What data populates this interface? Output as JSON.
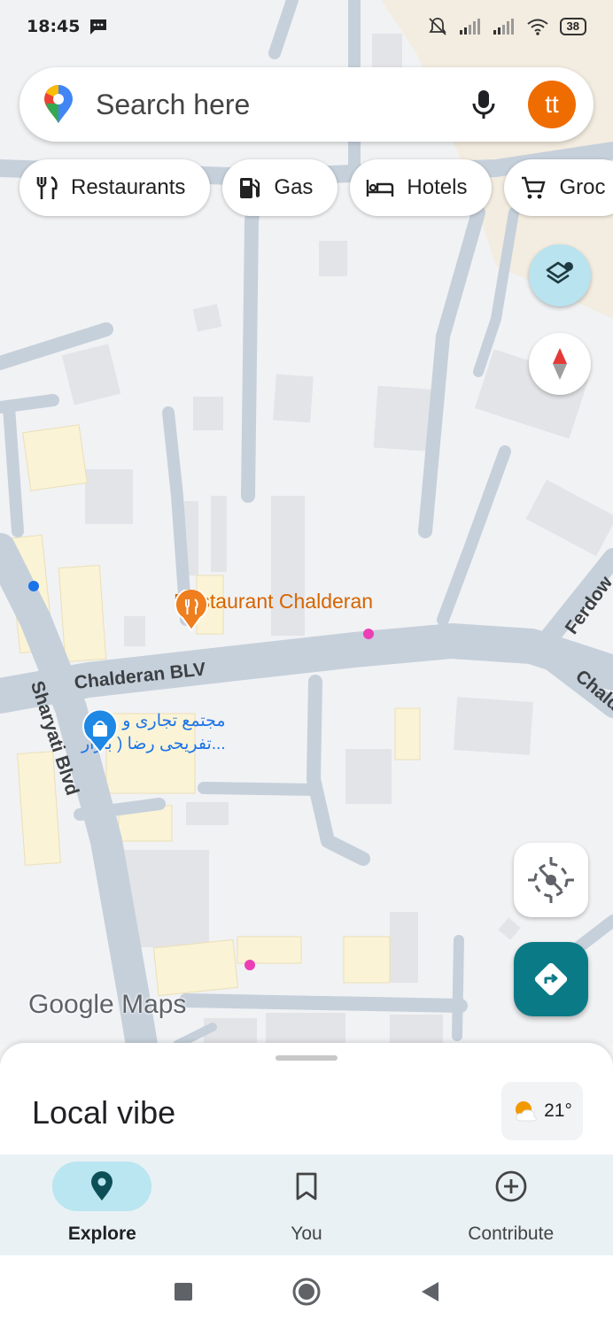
{
  "status_bar": {
    "time": "18:45",
    "battery": "38",
    "icons": [
      "message-icon",
      "mute-icon",
      "signal-icon",
      "signal-icon",
      "wifi-icon",
      "battery-icon"
    ]
  },
  "search": {
    "placeholder": "Search here",
    "avatar_initials": "tt",
    "colors": {
      "avatar": "#ef6c00"
    }
  },
  "chips": [
    {
      "label": "Restaurants",
      "icon": "fork-knife-icon"
    },
    {
      "label": "Gas",
      "icon": "gas-pump-icon"
    },
    {
      "label": "Hotels",
      "icon": "bed-icon"
    },
    {
      "label": "Groc",
      "icon": "cart-icon"
    }
  ],
  "map": {
    "streets": {
      "chalderan_blv": "Chalderan BLV",
      "sharyati_blvd": "Sharyati Blvd",
      "ferdow": "Ferdow",
      "chalde": "Chalde"
    },
    "pois": {
      "restaurant": "Restaurant Chalderan",
      "mall_line1": "مجتمع تجاری و",
      "mall_line2": "تفریحی رضا ( بازار..."
    },
    "watermark": "Google Maps",
    "controls": [
      "layers-icon",
      "compass-icon",
      "location-disabled-icon",
      "directions-icon"
    ]
  },
  "sheet": {
    "title": "Local vibe",
    "temperature": "21°",
    "weather_icon": "partly-cloudy-icon"
  },
  "nav": {
    "items": [
      {
        "label": "Explore",
        "icon": "pin-icon",
        "active": true
      },
      {
        "label": "You",
        "icon": "bookmark-icon",
        "active": false
      },
      {
        "label": "Contribute",
        "icon": "add-circle-icon",
        "active": false
      }
    ],
    "accent": "#0b7a87"
  },
  "system_nav": [
    "recents-square-icon",
    "home-circle-icon",
    "back-triangle-icon"
  ]
}
